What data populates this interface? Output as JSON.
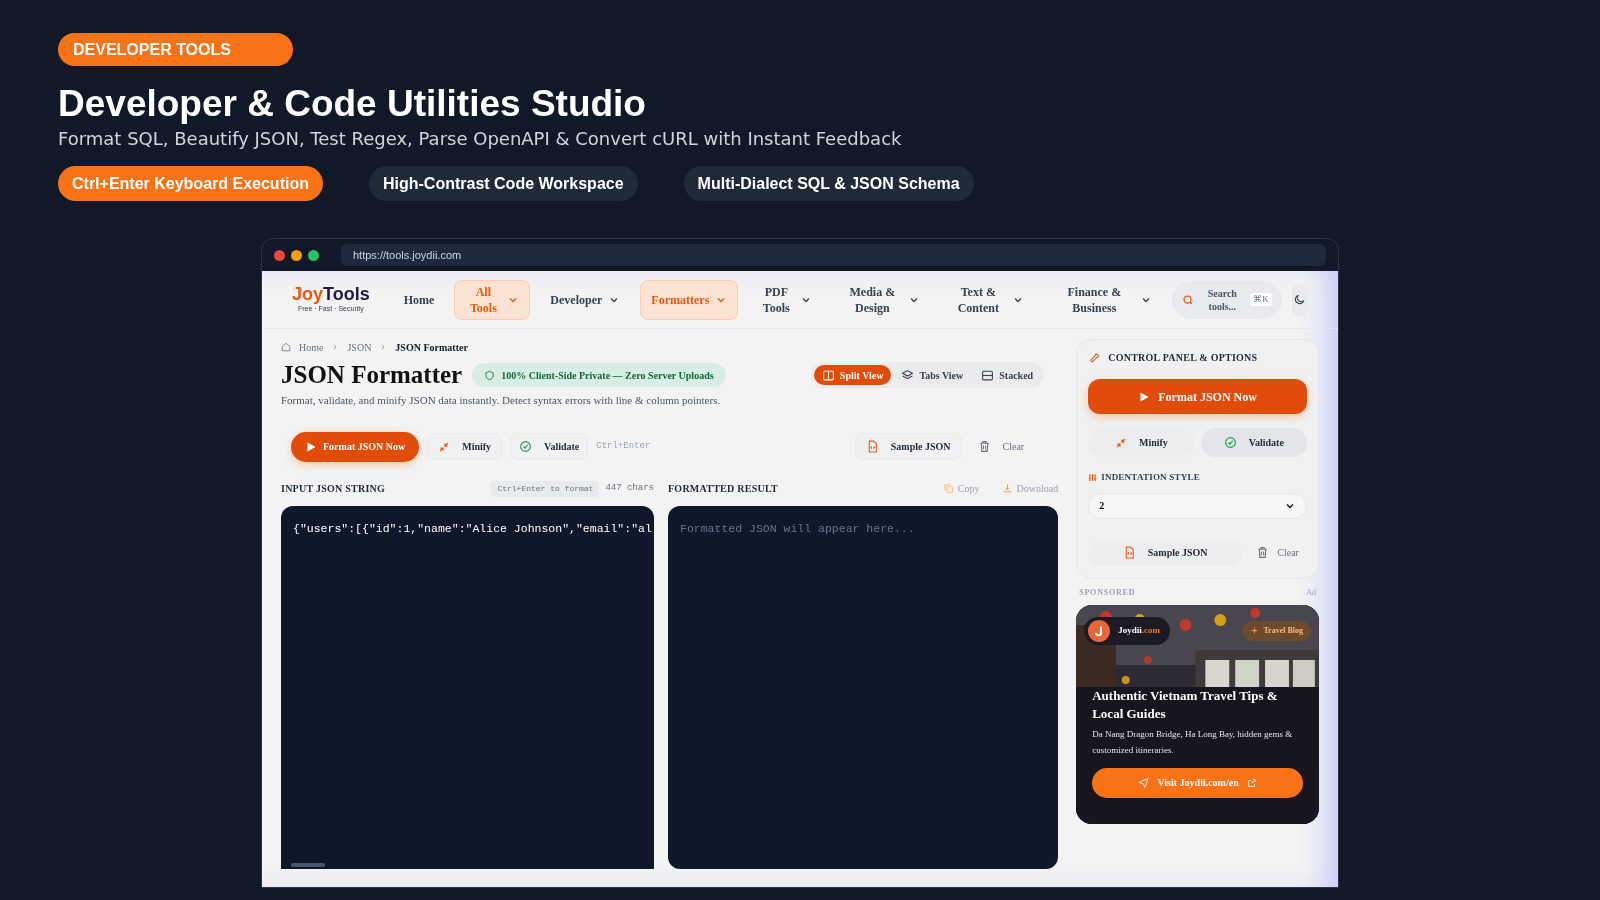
{
  "banner": {
    "badge": "DEVELOPER TOOLS",
    "title": "Developer & Code Utilities Studio",
    "subtitle": "Format SQL, Beautify JSON, Test Regex, Parse OpenAPI & Convert cURL with Instant Feedback",
    "pills": [
      {
        "label": "Ctrl+Enter Keyboard Execution",
        "selected": true
      },
      {
        "label": "High-Contrast Code Workspace",
        "selected": false
      },
      {
        "label": "Multi-Dialect SQL & JSON Schema",
        "selected": false
      }
    ]
  },
  "browser": {
    "url": "https://tools.joydii.com"
  },
  "nav": {
    "logo": {
      "first": "Joy",
      "second": "Tools",
      "tagline": "Free · Fast · Security"
    },
    "items": [
      {
        "label": "Home",
        "dropdown": false,
        "selected": false
      },
      {
        "label": "All Tools",
        "dropdown": true,
        "selected": true
      },
      {
        "label": "Developer",
        "dropdown": true,
        "selected": false
      },
      {
        "label": "Formatters",
        "dropdown": true,
        "selected": true
      },
      {
        "label": "PDF Tools",
        "dropdown": true,
        "selected": false
      },
      {
        "label": "Media & Design",
        "dropdown": true,
        "selected": false
      },
      {
        "label": "Text & Content",
        "dropdown": true,
        "selected": false
      },
      {
        "label": "Finance & Business",
        "dropdown": true,
        "selected": false
      }
    ],
    "search": {
      "placeholder": "Search tools...",
      "shortcut": "⌘K"
    }
  },
  "breadcrumb": [
    "Home",
    "JSON",
    "JSON Formatter"
  ],
  "page": {
    "title": "JSON Formatter",
    "privacy_badge": "100% Client-Side Private — Zero Server Uploads",
    "description": "Format, validate, and minify JSON data instantly. Detect syntax errors with line & column pointers.",
    "view_tabs": [
      {
        "label": "Split View",
        "kind": "split",
        "selected": true
      },
      {
        "label": "Tabs View",
        "kind": "tabs",
        "selected": false
      },
      {
        "label": "Stacked",
        "kind": "stacked",
        "selected": false
      }
    ],
    "actions": {
      "format": "Format JSON Now",
      "minify": "Minify",
      "validate": "Validate",
      "hint": "Ctrl+Enter",
      "sample": "Sample JSON",
      "clear": "Clear"
    },
    "input": {
      "label": "INPUT JSON STRING",
      "hint": "Ctrl+Enter to format",
      "count": "447 chars",
      "value": "{\"users\":[{\"id\":1,\"name\":\"Alice Johnson\",\"email\":\"al"
    },
    "output": {
      "label": "FORMATTED RESULT",
      "copy": "Copy",
      "download": "Download",
      "placeholder": "Formatted JSON will appear here..."
    }
  },
  "sidebar": {
    "heading": "CONTROL PANEL & OPTIONS",
    "format": "Format JSON Now",
    "minify": "Minify",
    "validate": "Validate",
    "indent_label": "INDENTATION STYLE",
    "indent_value": "2",
    "sample": "Sample JSON",
    "clear": "Clear"
  },
  "ad": {
    "sponsored": "SPONSORED",
    "ad_label": "Ad",
    "brand_name": "Joydii",
    "brand_suffix": ".com",
    "tag": "Travel Blog",
    "headline": "Authentic Vietnam Travel Tips & Local Guides",
    "text": "Da Nang Dragon Bridge, Ha Long Bay, hidden gems & customized itineraries.",
    "cta": "Visit Joydii.com/en"
  }
}
